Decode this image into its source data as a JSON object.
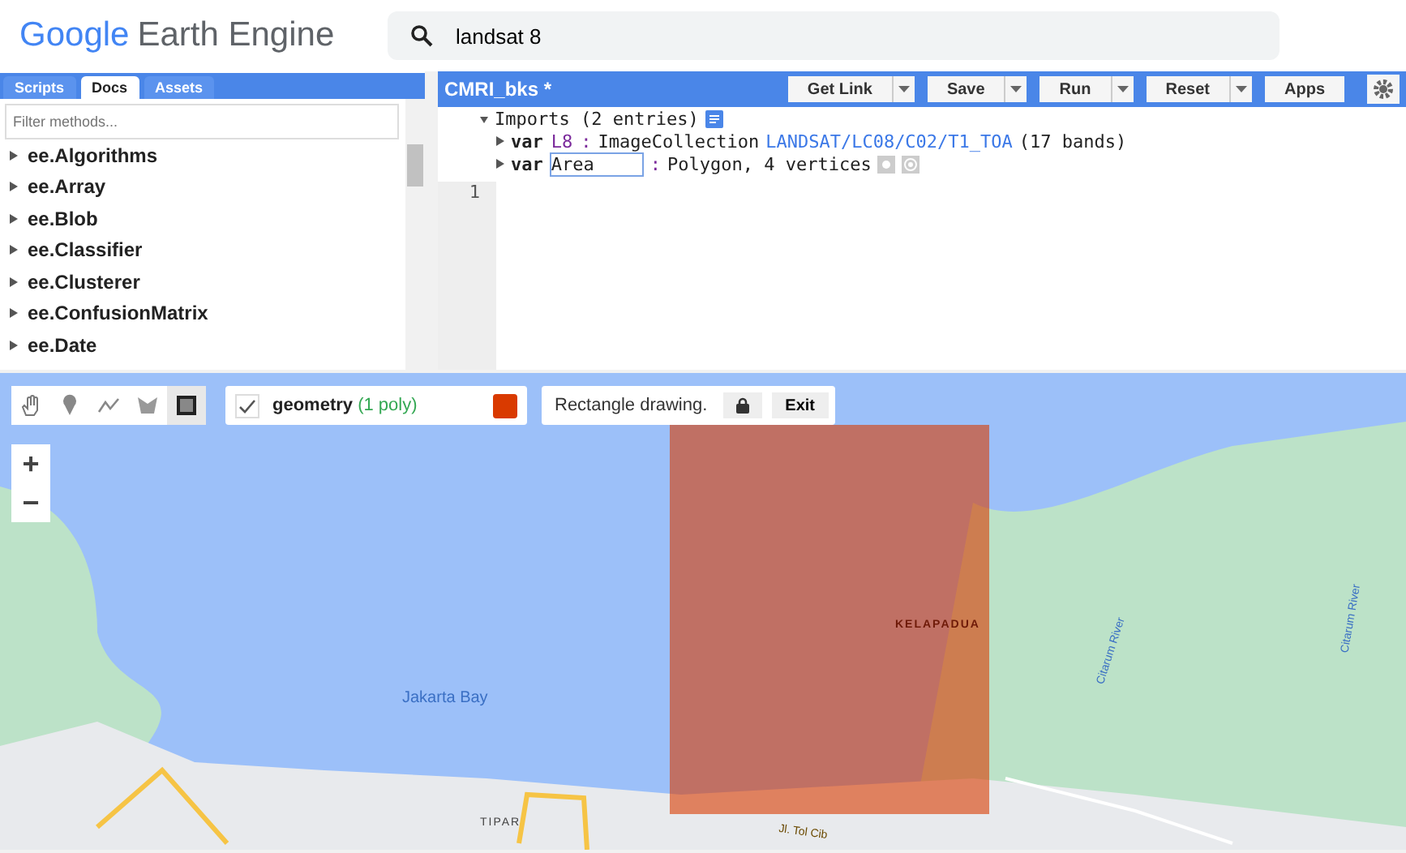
{
  "header": {
    "logo_brand": "Google",
    "logo_product": "Earth Engine",
    "search": {
      "value": "landsat 8"
    }
  },
  "left_panel": {
    "tabs": [
      {
        "label": "Scripts",
        "selected": false
      },
      {
        "label": "Docs",
        "selected": true
      },
      {
        "label": "Assets",
        "selected": false
      }
    ],
    "filter": {
      "placeholder": "Filter methods..."
    },
    "items": [
      "ee.Algorithms",
      "ee.Array",
      "ee.Blob",
      "ee.Classifier",
      "ee.Clusterer",
      "ee.ConfusionMatrix",
      "ee.Date"
    ]
  },
  "editor": {
    "title": "CMRI_bks *",
    "buttons": [
      {
        "label": "Get Link",
        "dropdown": true
      },
      {
        "label": "Save",
        "dropdown": true
      },
      {
        "label": "Run",
        "dropdown": true
      },
      {
        "label": "Reset",
        "dropdown": true
      },
      {
        "label": "Apps",
        "dropdown": false
      }
    ],
    "imports": {
      "label": "Imports (2 entries)",
      "expanded": true
    },
    "import_lines": [
      {
        "keyword": "var",
        "name": "L8",
        "editing": false,
        "separator": ":",
        "type": "ImageCollection",
        "link": "LANDSAT/LC08/C02/T1_TOA",
        "rest": "(17 bands)"
      },
      {
        "keyword": "var",
        "name": "Area",
        "editing": true,
        "separator": ":",
        "type": "Polygon, 4 vertices"
      }
    ],
    "line_numbers": [
      "1"
    ]
  },
  "map": {
    "tools": [
      {
        "kind": "hand",
        "selected": false
      },
      {
        "kind": "point",
        "selected": false
      },
      {
        "kind": "line",
        "selected": false
      },
      {
        "kind": "polygon",
        "selected": false
      },
      {
        "kind": "rectangle",
        "selected": true
      }
    ],
    "layer": {
      "name": "geometry",
      "count": "(1 poly)",
      "checked": true,
      "color": "#d93a00"
    },
    "hint": "Rectangle drawing.",
    "exit": "Exit",
    "zoom": [
      "+",
      "−"
    ],
    "labels": [
      {
        "kind": "water",
        "text": "Jakarta Bay"
      },
      {
        "kind": "place",
        "text": "KELAPADUA"
      },
      {
        "kind": "river",
        "text": "Citarum River"
      },
      {
        "kind": "river2",
        "text": "Citarum River"
      },
      {
        "kind": "town",
        "text": "TIPAR"
      },
      {
        "kind": "road",
        "text": "Jl. Tol Cib"
      }
    ]
  }
}
